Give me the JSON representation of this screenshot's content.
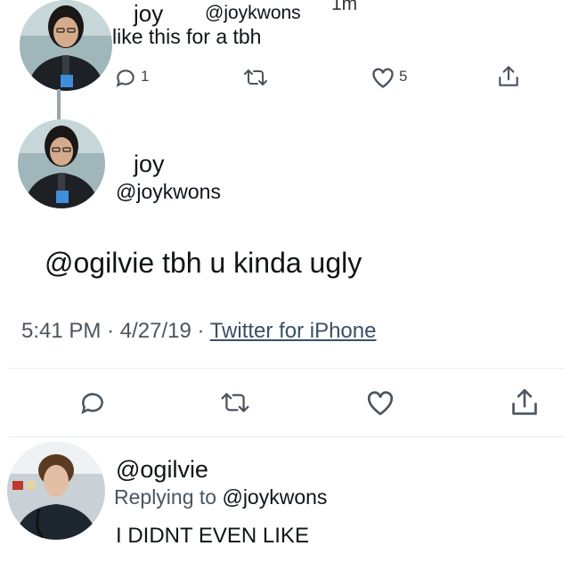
{
  "top_tweet": {
    "name": "joy",
    "handle": "@joykwons",
    "time": "1m",
    "text": "like this for a tbh",
    "reply_count": "1",
    "like_count": "5"
  },
  "main_tweet": {
    "name": "joy",
    "handle": "@joykwons",
    "text": "@ogilvie tbh u kinda ugly",
    "time": "5:41 PM",
    "separator": "·",
    "date": "4/27/19",
    "source": "Twitter for iPhone"
  },
  "reply_tweet": {
    "handle": "@ogilvie",
    "replying_label": "Replying to",
    "replying_to": "@joykwons",
    "text": "I DIDNT EVEN LIKE"
  },
  "colors": {
    "icon_gray": "#5a6570",
    "text_muted": "#536471",
    "divider": "#e6ecf0"
  }
}
